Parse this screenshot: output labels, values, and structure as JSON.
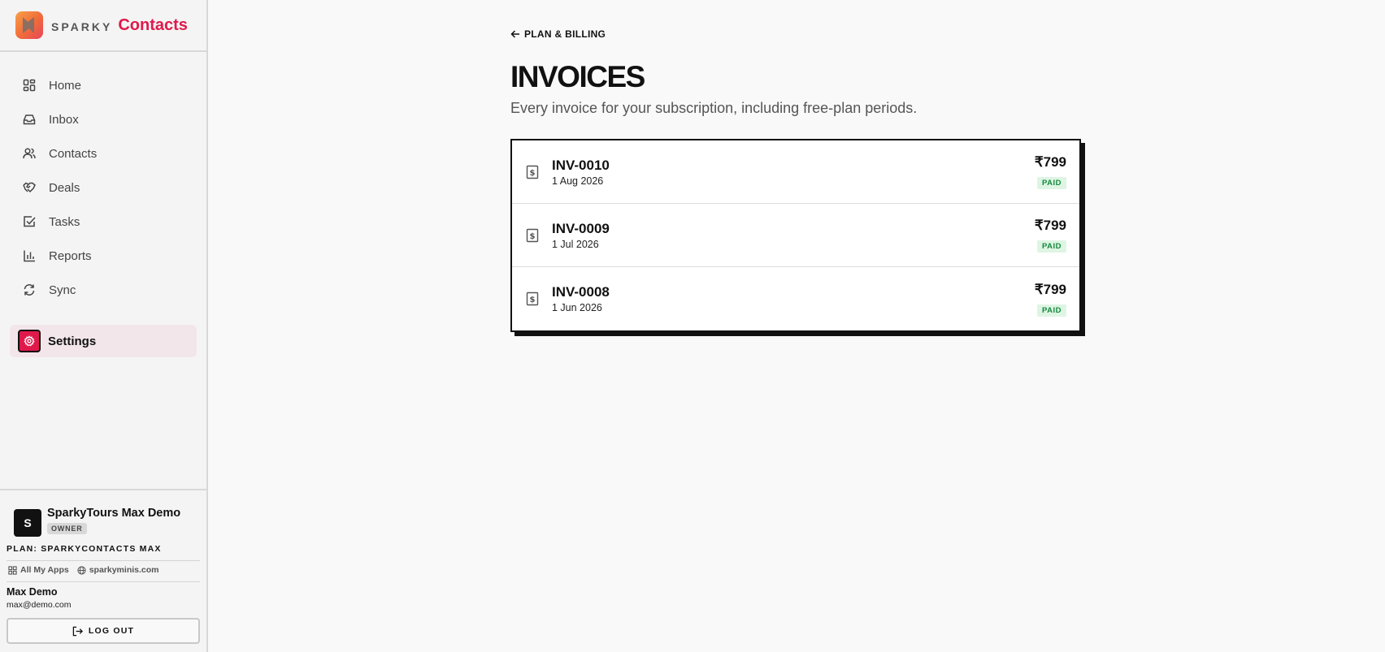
{
  "brand": {
    "prefix": "SPARKY",
    "name": "Contacts",
    "accent": "#e0194b"
  },
  "nav": {
    "items": [
      {
        "label": "Home",
        "icon": "grid-icon"
      },
      {
        "label": "Inbox",
        "icon": "inbox-icon"
      },
      {
        "label": "Contacts",
        "icon": "users-icon"
      },
      {
        "label": "Deals",
        "icon": "handshake-icon"
      },
      {
        "label": "Tasks",
        "icon": "check-square-icon"
      },
      {
        "label": "Reports",
        "icon": "bar-chart-icon"
      },
      {
        "label": "Sync",
        "icon": "refresh-icon"
      }
    ],
    "active": {
      "label": "Settings",
      "icon": "gear-icon"
    }
  },
  "account": {
    "avatar_letter": "S",
    "org_name": "SparkyTours Max Demo",
    "role_badge": "OWNER",
    "plan": "PLAN: SPARKYCONTACTS MAX",
    "links": [
      {
        "label": "All My Apps",
        "icon": "apps-icon"
      },
      {
        "label": "sparkyminis.com",
        "icon": "globe-icon"
      }
    ],
    "user_name": "Max Demo",
    "user_email": "max@demo.com",
    "logout_label": "LOG OUT"
  },
  "page": {
    "back_label": "PLAN & BILLING",
    "title": "INVOICES",
    "subtitle": "Every invoice for your subscription, including free-plan periods."
  },
  "invoices": [
    {
      "id": "INV-0010",
      "date": "1 Aug 2026",
      "amount": "₹799",
      "status": "PAID"
    },
    {
      "id": "INV-0009",
      "date": "1 Jul 2026",
      "amount": "₹799",
      "status": "PAID"
    },
    {
      "id": "INV-0008",
      "date": "1 Jun 2026",
      "amount": "₹799",
      "status": "PAID"
    }
  ]
}
